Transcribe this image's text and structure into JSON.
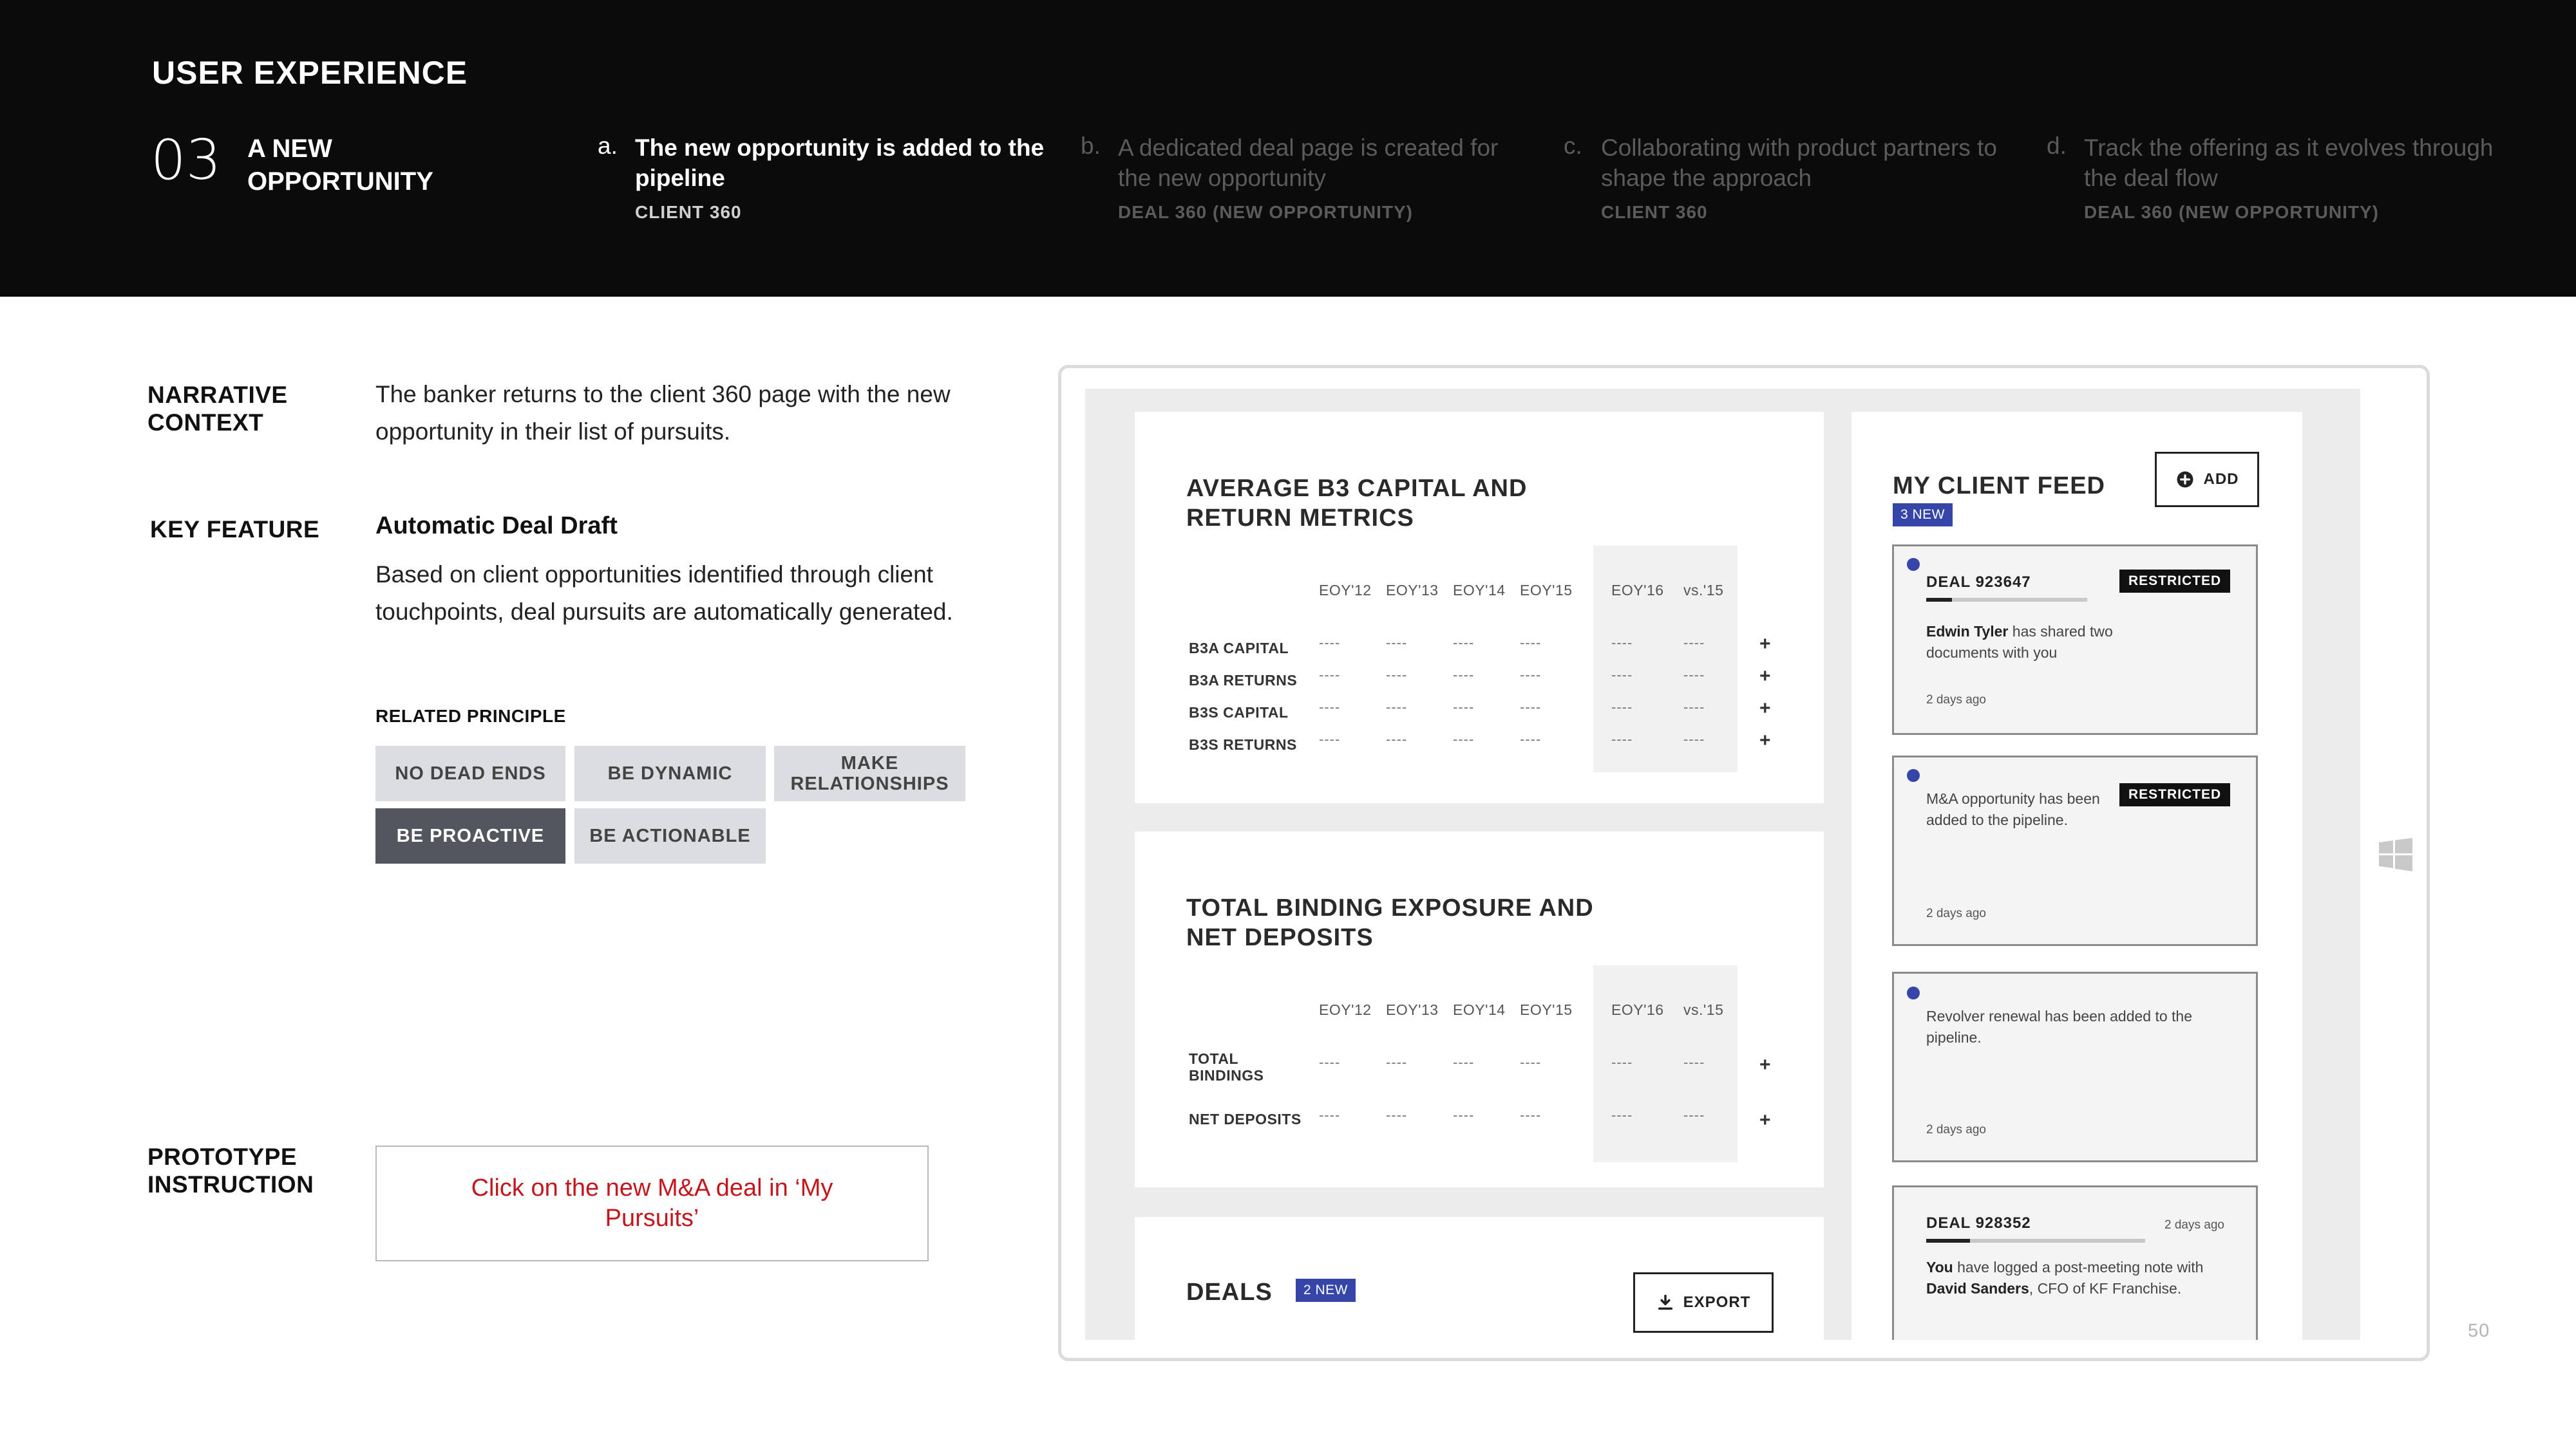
{
  "header": {
    "title": "USER EXPERIENCE",
    "section_number": "03",
    "section_title": "A NEW OPPORTUNITY",
    "steps": [
      {
        "letter": "a.",
        "text": "The new opportunity is added to the pipeline",
        "sub": "CLIENT 360"
      },
      {
        "letter": "b.",
        "text": "A dedicated deal page is created for the new opportunity",
        "sub": "DEAL 360 (NEW OPPORTUNITY)"
      },
      {
        "letter": "c.",
        "text": "Collaborating with product partners to shape the approach",
        "sub": "CLIENT 360"
      },
      {
        "letter": "d.",
        "text": "Track the offering as it evolves through the deal flow",
        "sub": "DEAL 360 (NEW OPPORTUNITY)"
      }
    ]
  },
  "left": {
    "narrative_label": "NARRATIVE CONTEXT",
    "narrative_text": "The banker returns to the client 360 page with the new opportunity in their list of pursuits.",
    "key_feature_label": "KEY FEATURE",
    "key_feature_title": "Automatic Deal Draft",
    "key_feature_text": "Based on client opportunities identified through client touchpoints, deal pursuits are automatically generated.",
    "related_label": "RELATED PRINCIPLE",
    "principles": [
      "NO DEAD ENDS",
      "BE DYNAMIC",
      "MAKE RELATIONSHIPS",
      "BE PROACTIVE",
      "BE ACTIONABLE"
    ],
    "prototype_label": "PROTOTYPE INSTRUCTION",
    "prototype_text": "Click on the new M&A deal in ‘My Pursuits’"
  },
  "mockup": {
    "columns": [
      "EOY'12",
      "EOY'13",
      "EOY'14",
      "EOY'15",
      "EOY'16",
      "vs.'15"
    ],
    "dash": "----",
    "plus": "+",
    "card1": {
      "title": "AVERAGE B3 CAPITAL AND RETURN METRICS",
      "rows": [
        "B3A CAPITAL",
        "B3A RETURNS",
        "B3S CAPITAL",
        "B3S RETURNS"
      ]
    },
    "card2": {
      "title": "TOTAL BINDING EXPOSURE AND NET DEPOSITS",
      "rows": [
        "TOTAL BINDINGS",
        "NET DEPOSITS"
      ]
    },
    "deals": {
      "title": "DEALS",
      "badge": "2 NEW",
      "export_label": "EXPORT"
    },
    "feed": {
      "title": "MY CLIENT FEED",
      "badge": "3 NEW",
      "add_label": "ADD",
      "restricted": "RESTRICTED",
      "items": [
        {
          "deal": "DEAL 923647",
          "text_strong": "Edwin Tyler",
          "text": " has shared two documents with you",
          "time": "2 days ago"
        },
        {
          "text": "M&A opportunity has been added to the pipeline.",
          "time": "2 days ago"
        },
        {
          "text": "Revolver renewal has been added to the pipeline.",
          "time": "2 days ago"
        },
        {
          "deal": "DEAL 928352",
          "time": "2 days ago",
          "text_a": "You",
          "text_b": " have logged a post-meeting note with ",
          "text_c": "David Sanders",
          "text_d": ", CFO of KF Franchise."
        }
      ]
    }
  },
  "page_number": "50"
}
